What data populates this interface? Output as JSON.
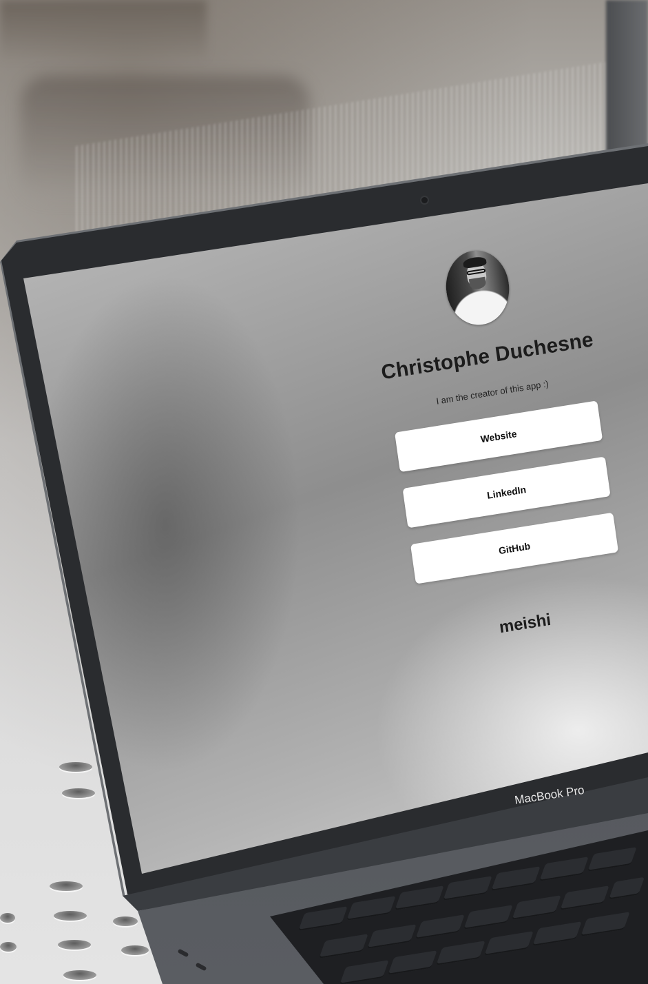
{
  "profile": {
    "name": "Christophe Duchesne",
    "bio": "I am the creator of this app :)"
  },
  "links": [
    {
      "label": "Website"
    },
    {
      "label": "LinkedIn"
    },
    {
      "label": "GitHub"
    }
  ],
  "footer": {
    "brand": "meishi"
  },
  "device": {
    "label": "MacBook Pro"
  },
  "icons": {
    "avatar": "profile-photo",
    "camera": "webcam-dot"
  }
}
